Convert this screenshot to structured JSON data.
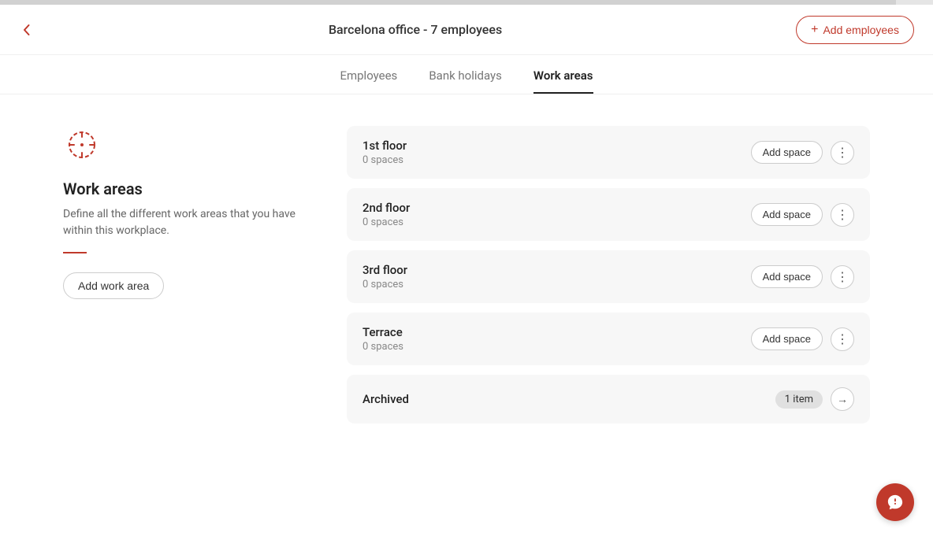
{
  "topBar": {
    "fillWidth": "96%"
  },
  "header": {
    "title": "Barcelona office - 7 employees",
    "addEmployeesLabel": "Add employees",
    "backArrow": "←"
  },
  "tabs": [
    {
      "id": "employees",
      "label": "Employees",
      "active": false
    },
    {
      "id": "bank-holidays",
      "label": "Bank holidays",
      "active": false
    },
    {
      "id": "work-areas",
      "label": "Work areas",
      "active": true
    }
  ],
  "leftPanel": {
    "iconAlt": "work-areas-icon",
    "title": "Work areas",
    "description": "Define all the different work areas that you have within this workplace.",
    "addWorkAreaLabel": "Add work area"
  },
  "workAreas": [
    {
      "id": "1st-floor",
      "name": "1st floor",
      "spaces": "0 spaces",
      "addSpaceLabel": "Add space"
    },
    {
      "id": "2nd-floor",
      "name": "2nd floor",
      "spaces": "0 spaces",
      "addSpaceLabel": "Add space"
    },
    {
      "id": "3rd-floor",
      "name": "3rd floor",
      "spaces": "0 spaces",
      "addSpaceLabel": "Add space"
    },
    {
      "id": "terrace",
      "name": "Terrace",
      "spaces": "0 spaces",
      "addSpaceLabel": "Add space"
    }
  ],
  "archived": {
    "label": "Archived",
    "badge": "1 item",
    "arrowLabel": "→"
  },
  "colors": {
    "accent": "#c0392b",
    "tabActive": "#222",
    "cardBg": "#f7f7f7"
  }
}
